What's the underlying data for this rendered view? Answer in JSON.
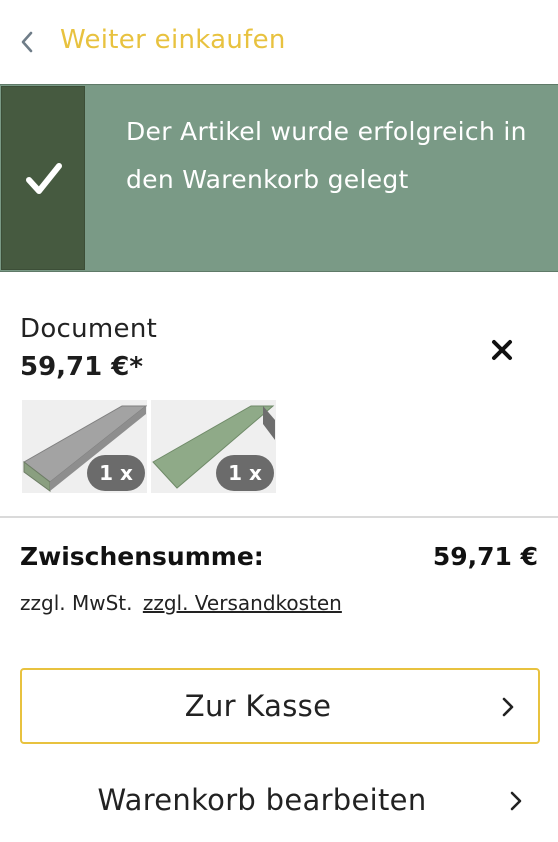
{
  "header": {
    "back_label": "Weiter einkaufen",
    "back_icon": "chevron-left-icon"
  },
  "banner": {
    "message": "Der Artikel wurde erfolgreich in den Warenkorb gelegt",
    "icon": "checkmark-icon"
  },
  "item": {
    "name": "Document",
    "price": "59,71 €*",
    "remove_icon": "close-icon",
    "variants": [
      {
        "quantity": "1 x",
        "color": "#a3a3a3"
      },
      {
        "quantity": "1 x",
        "color": "#8faa88"
      }
    ]
  },
  "summary": {
    "subtotal_label": "Zwischensumme:",
    "subtotal_value": "59,71 €",
    "tax_note": "zzgl. MwSt.",
    "shipping_link": "zzgl. Versandkosten"
  },
  "actions": {
    "checkout_label": "Zur Kasse",
    "edit_cart_label": "Warenkorb bearbeiten"
  },
  "colors": {
    "accent": "#e8c23f",
    "banner_bg": "#7a9a86",
    "check_bg": "#465a40"
  }
}
